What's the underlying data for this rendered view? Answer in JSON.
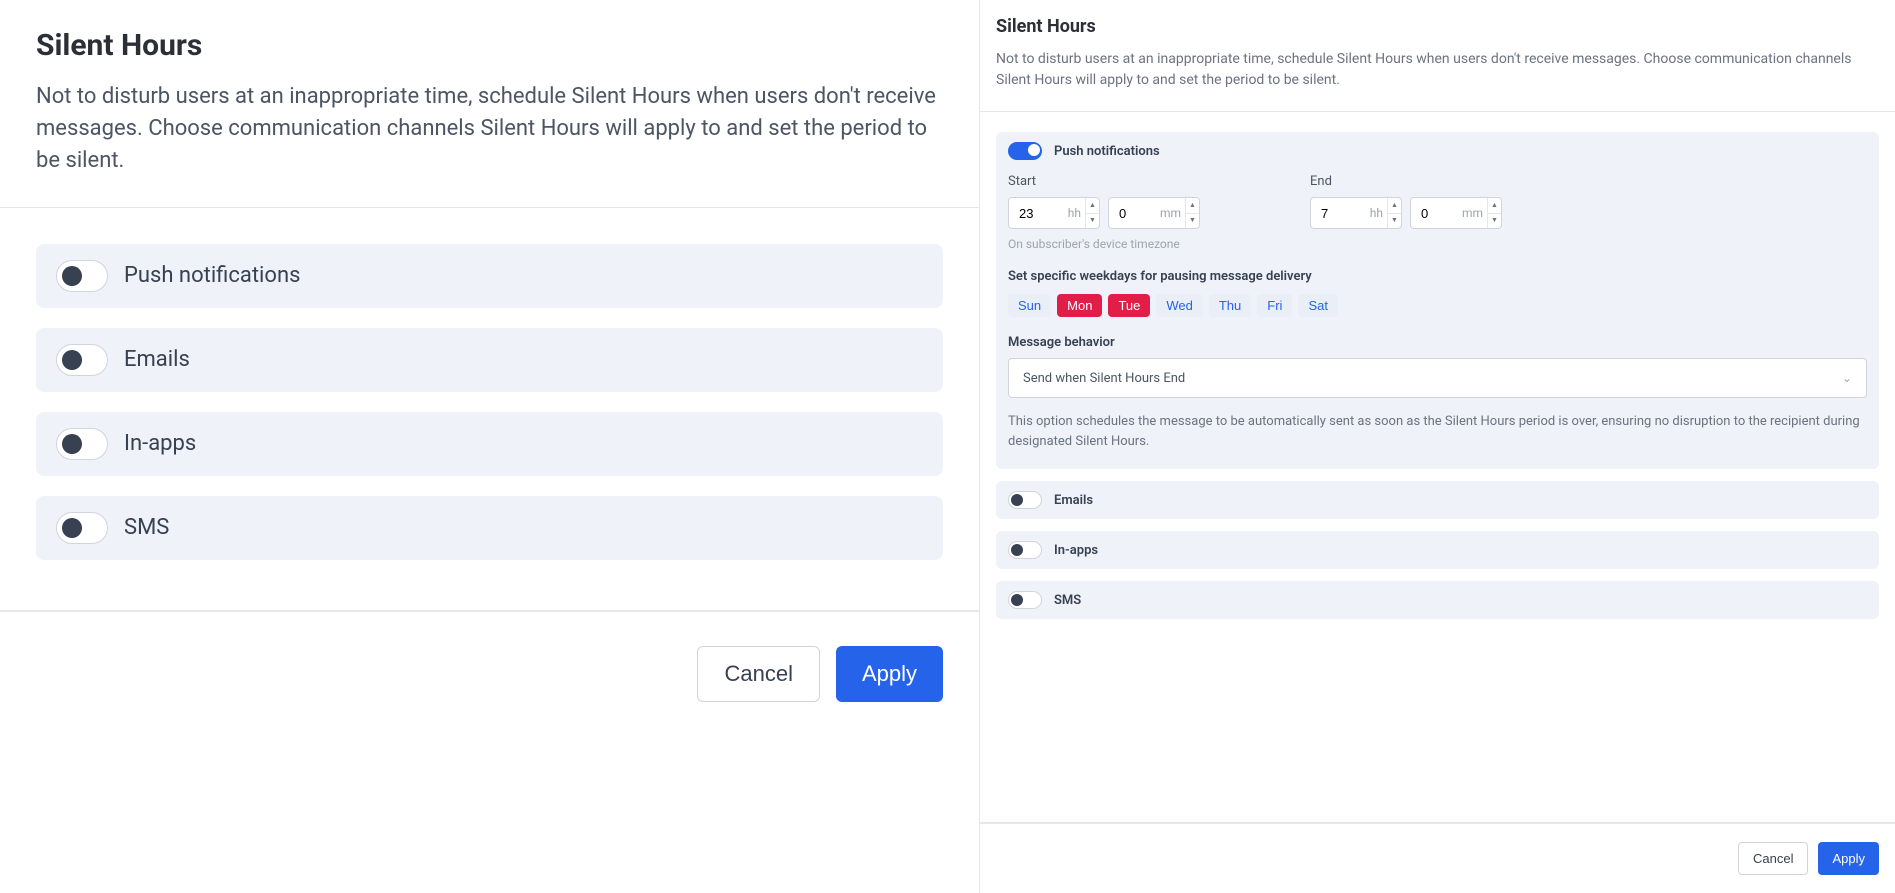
{
  "left": {
    "title": "Silent Hours",
    "description": "Not to disturb users at an inappropriate time, schedule Silent Hours when users don't receive messages. Choose communication channels Silent Hours will apply to and set the period to be silent.",
    "channels": [
      {
        "label": "Push notifications"
      },
      {
        "label": "Emails"
      },
      {
        "label": "In-apps"
      },
      {
        "label": "SMS"
      }
    ],
    "cancel": "Cancel",
    "apply": "Apply"
  },
  "right": {
    "title": "Silent Hours",
    "description": "Not to disturb users at an inappropriate time, schedule Silent Hours when users don't receive messages. Choose communication channels Silent Hours will apply to and set the period to be silent.",
    "push": {
      "label": "Push notifications",
      "start_label": "Start",
      "end_label": "End",
      "start_hh": "23",
      "start_mm": "0",
      "end_hh": "7",
      "end_mm": "0",
      "hh_unit": "hh",
      "mm_unit": "mm",
      "tz_note": "On subscriber's device timezone",
      "weekday_header": "Set specific weekdays for pausing message delivery",
      "days": [
        {
          "label": "Sun",
          "active": false
        },
        {
          "label": "Mon",
          "active": true
        },
        {
          "label": "Tue",
          "active": true
        },
        {
          "label": "Wed",
          "active": false
        },
        {
          "label": "Thu",
          "active": false
        },
        {
          "label": "Fri",
          "active": false
        },
        {
          "label": "Sat",
          "active": false
        }
      ],
      "behavior_header": "Message behavior",
      "behavior_value": "Send when Silent Hours End",
      "behavior_note": "This option schedules the message to be automatically sent as soon as the Silent Hours period is over, ensuring no disruption to the recipient during designated Silent Hours."
    },
    "emails_label": "Emails",
    "inapps_label": "In-apps",
    "sms_label": "SMS",
    "cancel": "Cancel",
    "apply": "Apply"
  }
}
